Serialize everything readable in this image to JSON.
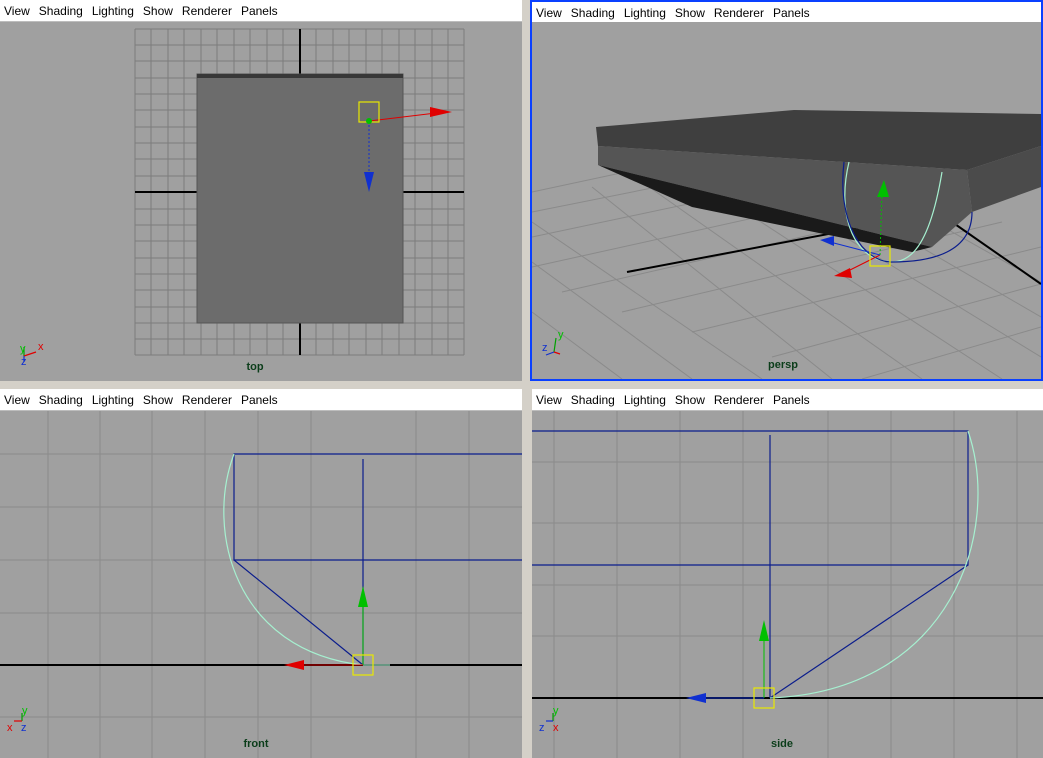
{
  "menu": [
    "View",
    "Shading",
    "Lighting",
    "Show",
    "Renderer",
    "Panels"
  ],
  "panels": {
    "top": {
      "camera": "top",
      "axis": [
        "y",
        "x",
        "z"
      ]
    },
    "persp": {
      "camera": "persp",
      "axis": [
        "y",
        "z"
      ]
    },
    "front": {
      "camera": "front",
      "axis": [
        "y",
        "x",
        "z"
      ]
    },
    "side": {
      "camera": "side",
      "axis": [
        "y",
        "z",
        "x"
      ]
    }
  },
  "colors": {
    "viewport_bg": "#a0a0a0",
    "grid": "#7c7c7c",
    "axis_line": "#000000",
    "active_border": "#0a40ff",
    "mesh_top": "#6c6c6c",
    "mesh_side": "#4a4a4a",
    "curve": "#a6f0d0",
    "wire": "#0b1d8c",
    "manip_x": "#e00000",
    "manip_y": "#00c000",
    "manip_z": "#1030d0",
    "selection": "#e8e800"
  },
  "icons": [
    "axis-triad-icon",
    "move-manipulator-icon"
  ]
}
